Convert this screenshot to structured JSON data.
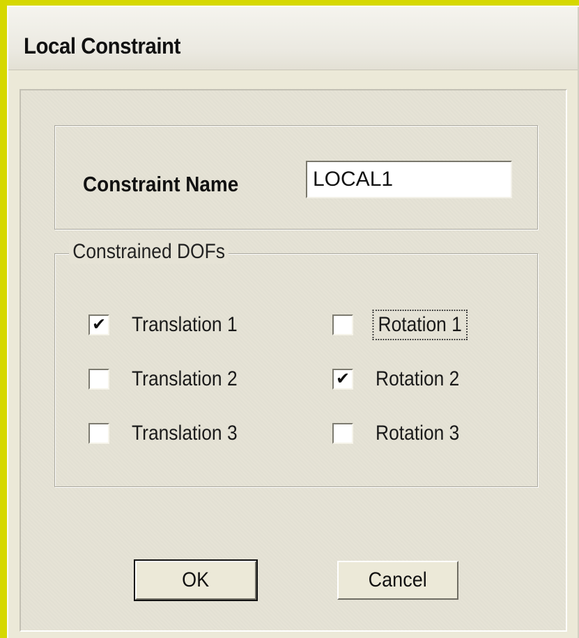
{
  "window": {
    "title": "Local Constraint"
  },
  "name_section": {
    "label": "Constraint Name",
    "value": "LOCAL1"
  },
  "dof_section": {
    "legend": "Constrained DOFs",
    "items": [
      {
        "label": "Translation 1",
        "checked": true,
        "focused": false
      },
      {
        "label": "Translation 2",
        "checked": false,
        "focused": false
      },
      {
        "label": "Translation 3",
        "checked": false,
        "focused": false
      },
      {
        "label": "Rotation 1",
        "checked": false,
        "focused": true
      },
      {
        "label": "Rotation 2",
        "checked": true,
        "focused": false
      },
      {
        "label": "Rotation 3",
        "checked": false,
        "focused": false
      }
    ],
    "check_glyph": "✔"
  },
  "buttons": {
    "ok_label": "OK",
    "cancel_label": "Cancel"
  },
  "colors": {
    "dialog_background": "#ece9d8",
    "outer_background": "#e8e800"
  }
}
